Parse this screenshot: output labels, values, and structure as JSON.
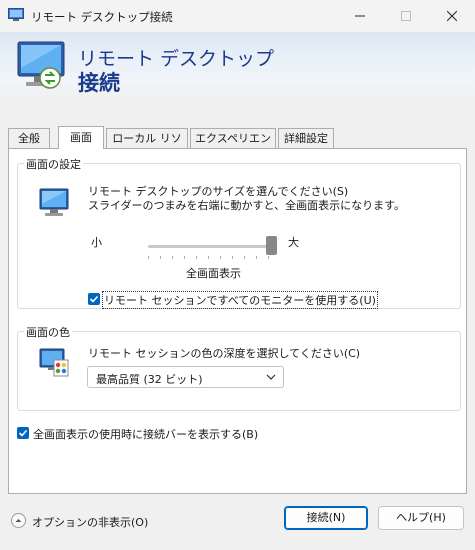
{
  "window": {
    "title": "リモート デスクトップ接続"
  },
  "banner": {
    "line1": "リモート デスクトップ",
    "line2": "接続"
  },
  "tabs": [
    {
      "label": "全般"
    },
    {
      "label": "画面"
    },
    {
      "label": "ローカル リソース"
    },
    {
      "label": "エクスペリエンス"
    },
    {
      "label": "詳細設定"
    }
  ],
  "display_settings": {
    "legend": "画面の設定",
    "desc_line1": "リモート デスクトップのサイズを選んでください(S)",
    "desc_line2": "スライダーのつまみを右端に動かすと、全画面表示になります。",
    "slider_min_label": "小",
    "slider_max_label": "大",
    "slider_value_label": "全画面表示",
    "slider_fraction": 1.0,
    "all_monitors_label": "リモート セッションですべてのモニターを使用する(U)",
    "all_monitors_checked": true
  },
  "colors": {
    "legend": "画面の色",
    "desc": "リモート セッションの色の深度を選択してください(C)",
    "selected": "最高品質 (32 ビット)"
  },
  "connection_bar": {
    "label": "全画面表示の使用時に接続バーを表示する(B)",
    "checked": true
  },
  "footer": {
    "options_label": "オプションの非表示(O)",
    "connect_label": "接続(N)",
    "help_label": "ヘルプ(H)"
  },
  "theme": {
    "accent": "#0067c0",
    "banner_text": "#1c3a8c"
  }
}
